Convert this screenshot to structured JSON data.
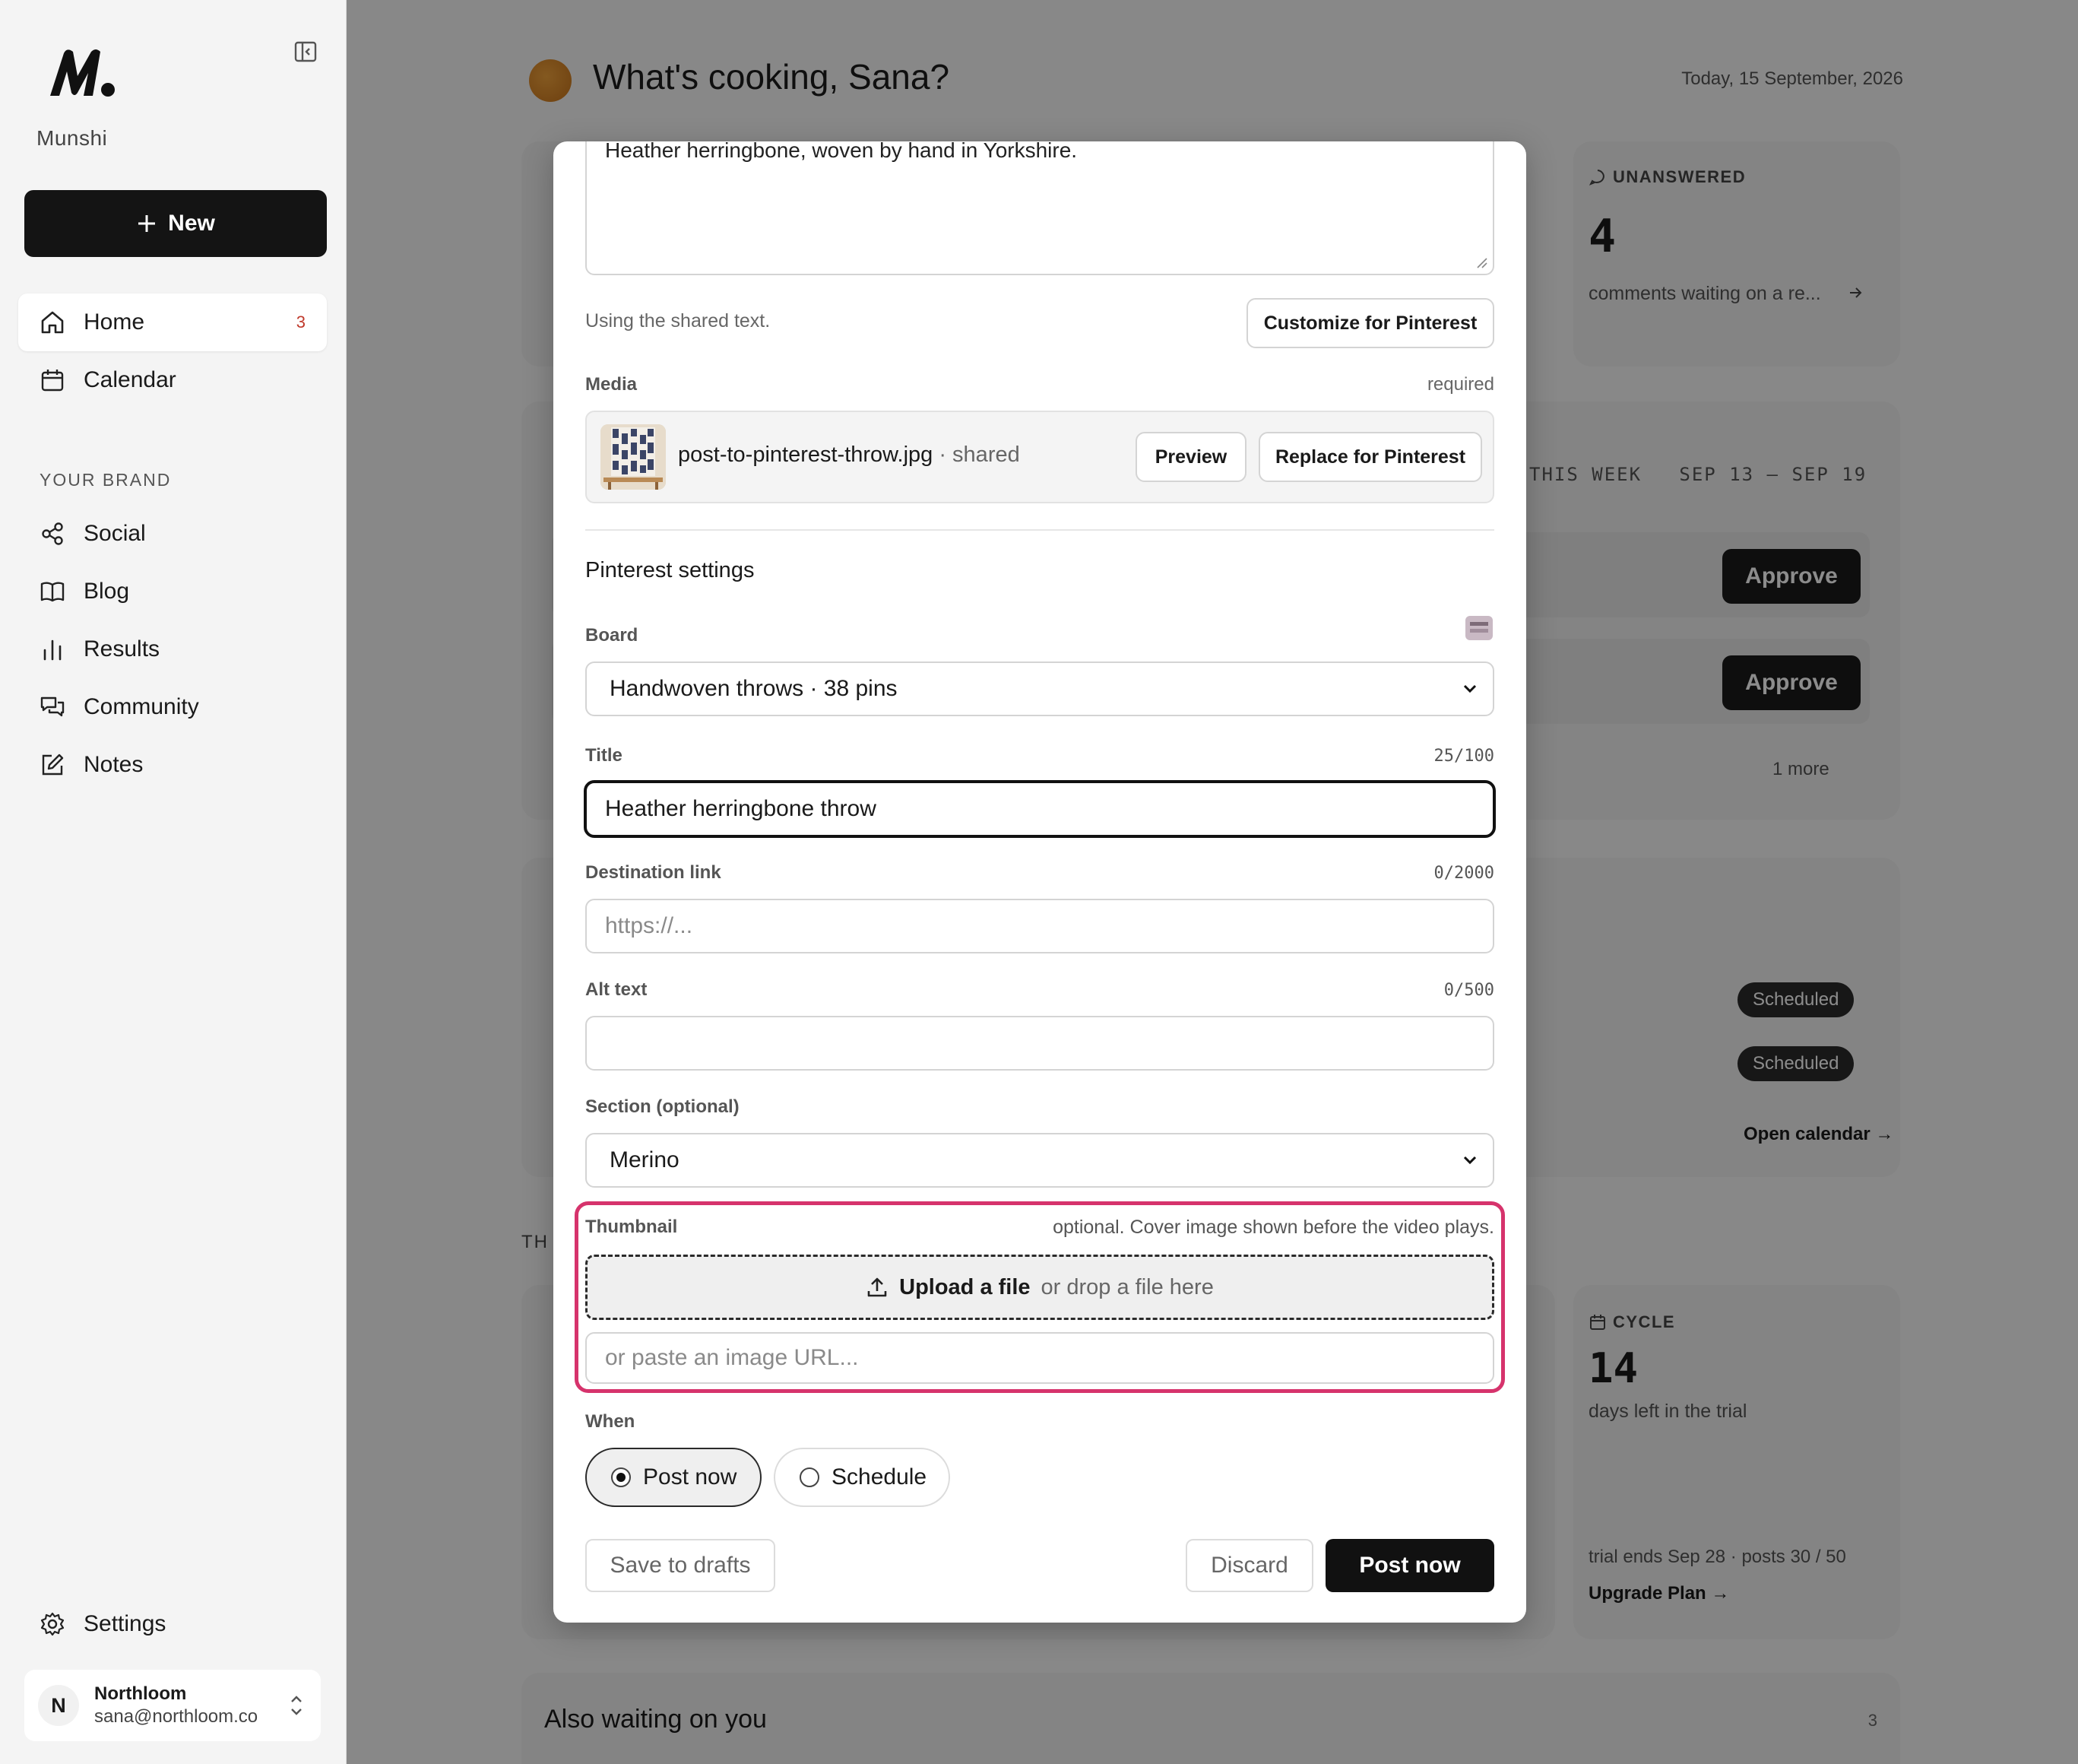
{
  "sidebar": {
    "brand": "Munshi",
    "new_label": "New",
    "nav": [
      {
        "label": "Home",
        "badge": "3"
      },
      {
        "label": "Calendar"
      }
    ],
    "section_label": "YOUR BRAND",
    "brand_nav": [
      {
        "label": "Social"
      },
      {
        "label": "Blog"
      },
      {
        "label": "Results"
      },
      {
        "label": "Community"
      },
      {
        "label": "Notes"
      }
    ],
    "settings_label": "Settings",
    "account": {
      "initial": "N",
      "name": "Northloom",
      "email": "sana@northloom.co"
    }
  },
  "main": {
    "greeting": "What's cooking, Sana?",
    "date": "Today, 15 September, 2026",
    "unanswered": {
      "label": "UNANSWERED",
      "value": "4",
      "desc": "comments waiting on a re..."
    },
    "week": {
      "label": "THIS WEEK",
      "range": "SEP 13 – SEP 19",
      "approve_label": "Approve",
      "more": "1 more"
    },
    "scheduled_label": "Scheduled",
    "open_calendar": "Open calendar →",
    "section_fragment": "TH",
    "cycle": {
      "label": "CYCLE",
      "value": "14",
      "desc": "days left in the trial",
      "meta": "trial ends Sep 28 · posts 30 / 50",
      "upgrade": "Upgrade Plan →"
    },
    "also_waiting": {
      "title": "Also waiting on you",
      "count": "3"
    }
  },
  "modal": {
    "caption_text": "Heather herringbone, woven by hand in Yorkshire.",
    "shared_note": "Using the shared text.",
    "customize_label": "Customize for Pinterest",
    "media": {
      "label": "Media",
      "required": "required",
      "filename": "post-to-pinterest-throw.jpg",
      "shared": "· shared",
      "preview_label": "Preview",
      "replace_label": "Replace for Pinterest"
    },
    "settings_heading": "Pinterest settings",
    "board": {
      "label": "Board",
      "value": "Handwoven throws · 38 pins"
    },
    "title": {
      "label": "Title",
      "counter": "25/100",
      "value": "Heather herringbone throw"
    },
    "destination": {
      "label": "Destination link",
      "counter": "0/2000",
      "placeholder": "https://..."
    },
    "alt": {
      "label": "Alt text",
      "counter": "0/500",
      "value": ""
    },
    "section": {
      "label": "Section (optional)",
      "value": "Merino"
    },
    "thumbnail": {
      "label": "Thumbnail",
      "hint": "optional. Cover image shown before the video plays.",
      "upload_label": "Upload a file",
      "drop_label": "or drop a file here",
      "url_placeholder": "or paste an image URL..."
    },
    "when": {
      "label": "When",
      "options": [
        "Post now",
        "Schedule"
      ],
      "selected": "Post now"
    },
    "footer": {
      "save_drafts": "Save to drafts",
      "discard": "Discard",
      "post_now": "Post now"
    }
  },
  "colors": {
    "accent_highlight": "#d6336c",
    "primary": "#141414",
    "badge": "#c0392b"
  }
}
